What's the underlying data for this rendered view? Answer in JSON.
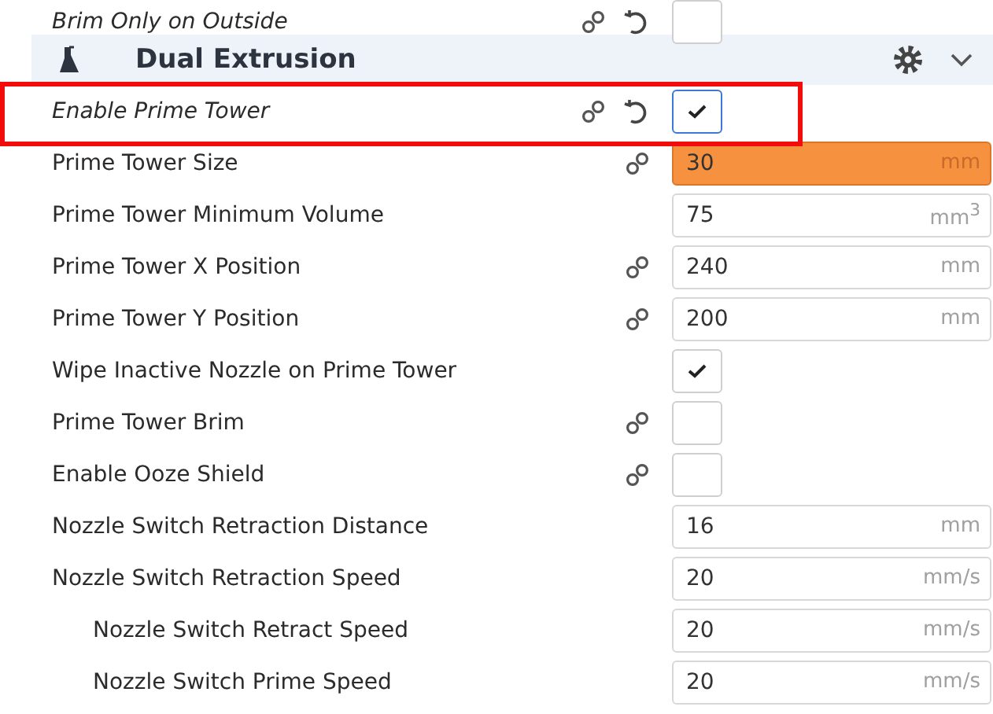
{
  "top_row": {
    "label": "Brim Only on Outside",
    "italic": true,
    "linked": true,
    "resettable": true,
    "kind": "checkbox",
    "checked": false
  },
  "section": {
    "title": "Dual Extrusion",
    "expanded": true
  },
  "settings": [
    {
      "kind": "checkbox",
      "label": "Enable Prime Tower",
      "italic": true,
      "linked": true,
      "resettable": true,
      "checked": true,
      "highlighted": true
    },
    {
      "kind": "number",
      "label": "Prime Tower Size",
      "italic": false,
      "linked": true,
      "resettable": false,
      "value": "30",
      "unit": "mm",
      "warning": true
    },
    {
      "kind": "number",
      "label": "Prime Tower Minimum Volume",
      "italic": false,
      "linked": false,
      "resettable": false,
      "value": "75",
      "unit": "mm$^{3}$",
      "warning": false
    },
    {
      "kind": "number",
      "label": "Prime Tower X Position",
      "italic": false,
      "linked": true,
      "resettable": false,
      "value": "240",
      "unit": "mm",
      "warning": false
    },
    {
      "kind": "number",
      "label": "Prime Tower Y Position",
      "italic": false,
      "linked": true,
      "resettable": false,
      "value": "200",
      "unit": "mm",
      "warning": false
    },
    {
      "kind": "checkbox",
      "label": "Wipe Inactive Nozzle on Prime Tower",
      "italic": false,
      "linked": false,
      "resettable": false,
      "checked": true
    },
    {
      "kind": "checkbox",
      "label": "Prime Tower Brim",
      "italic": false,
      "linked": true,
      "resettable": false,
      "checked": false
    },
    {
      "kind": "checkbox",
      "label": "Enable Ooze Shield",
      "italic": false,
      "linked": true,
      "resettable": false,
      "checked": false
    },
    {
      "kind": "number",
      "label": "Nozzle Switch Retraction Distance",
      "italic": false,
      "linked": false,
      "resettable": false,
      "value": "16",
      "unit": "mm",
      "warning": false
    },
    {
      "kind": "number",
      "label": "Nozzle Switch Retraction Speed",
      "italic": false,
      "linked": false,
      "resettable": false,
      "value": "20",
      "unit": "mm/s",
      "warning": false,
      "children": [
        {
          "kind": "number",
          "label": "Nozzle Switch Retract Speed",
          "italic": false,
          "linked": false,
          "resettable": false,
          "value": "20",
          "unit": "mm/s",
          "warning": false
        },
        {
          "kind": "number",
          "label": "Nozzle Switch Prime Speed",
          "italic": false,
          "linked": false,
          "resettable": false,
          "value": "20",
          "unit": "mm/s",
          "warning": false
        }
      ]
    }
  ]
}
